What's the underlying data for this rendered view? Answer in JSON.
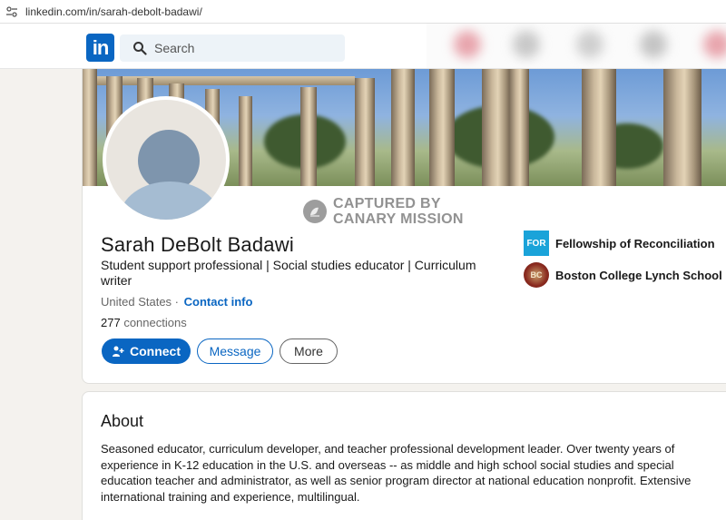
{
  "browser": {
    "url": "linkedin.com/in/sarah-debolt-badawi/"
  },
  "header": {
    "logo_text": "in",
    "search_placeholder": "Search"
  },
  "watermark": {
    "line1": "CAPTURED BY",
    "line2": "CANARY MISSION"
  },
  "profile": {
    "name": "Sarah DeBolt Badawi",
    "headline": "Student support professional | Social studies educator | Curriculum writer",
    "location": "United States ·",
    "contact_info": "Contact info",
    "connections_count": "277",
    "connections_label": "connections"
  },
  "actions": {
    "connect": "Connect",
    "message": "Message",
    "more": "More"
  },
  "organizations": [
    {
      "logo_text": "FOR",
      "name": "Fellowship of Reconciliation"
    },
    {
      "logo_text": "BC",
      "name": "Boston College Lynch School"
    }
  ],
  "about": {
    "title": "About",
    "text": "Seasoned educator, curriculum developer, and teacher professional development leader. Over twenty years of experience in K-12 education in the U.S. and overseas -- as middle and high school social studies and special education teacher and administrator, as well as senior program director at national education nonprofit. Extensive international training and experience, multilingual."
  },
  "colors": {
    "brand": "#0a66c2",
    "page_bg": "#f4f2ee"
  }
}
